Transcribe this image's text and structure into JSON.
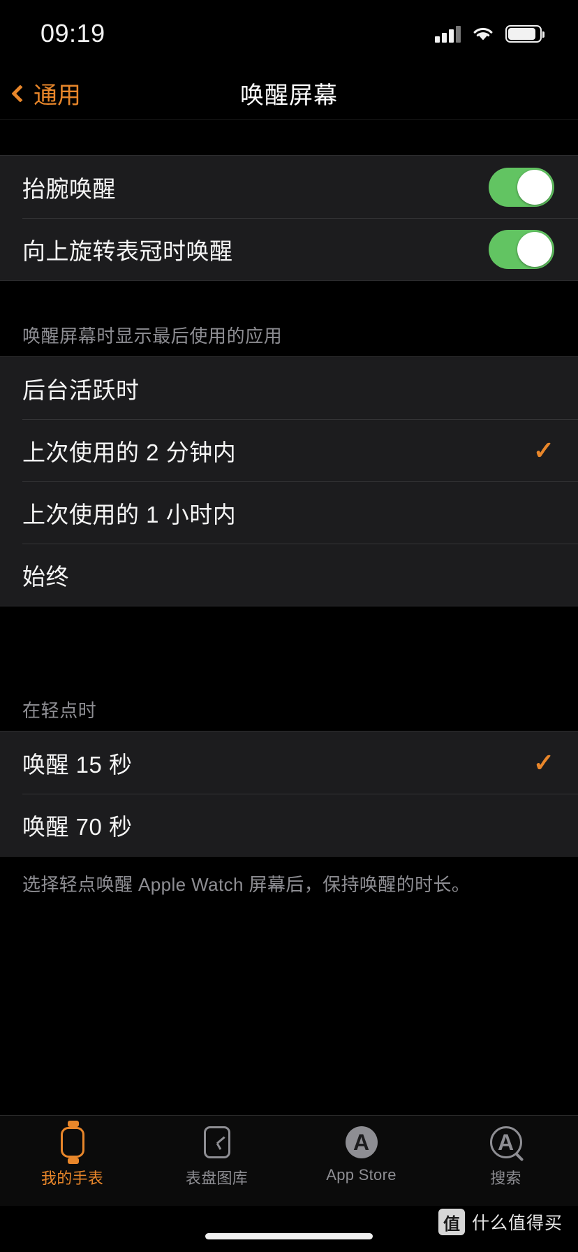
{
  "status": {
    "time": "09:19",
    "signal_icon": "cellular-signal-icon",
    "wifi_icon": "wifi-icon",
    "battery_icon": "battery-icon"
  },
  "nav": {
    "back_label": "通用",
    "title": "唤醒屏幕"
  },
  "toggles": [
    {
      "label": "抬腕唤醒",
      "on": true
    },
    {
      "label": "向上旋转表冠时唤醒",
      "on": true
    }
  ],
  "section_last_app": {
    "header": "唤醒屏幕时显示最后使用的应用",
    "options": [
      {
        "label": "后台活跃时",
        "selected": false
      },
      {
        "label": "上次使用的 2 分钟内",
        "selected": true
      },
      {
        "label": "上次使用的 1 小时内",
        "selected": false
      },
      {
        "label": "始终",
        "selected": false
      }
    ]
  },
  "section_on_tap": {
    "header": "在轻点时",
    "options": [
      {
        "label": "唤醒 15 秒",
        "selected": true
      },
      {
        "label": "唤醒 70 秒",
        "selected": false
      }
    ],
    "footnote": "选择轻点唤醒 Apple Watch 屏幕后，保持唤醒的时长。"
  },
  "tabbar": [
    {
      "label": "我的手表",
      "icon": "watch-icon",
      "active": true
    },
    {
      "label": "表盘图库",
      "icon": "watch-face-icon",
      "active": false
    },
    {
      "label": "App Store",
      "icon": "app-store-icon",
      "active": false
    },
    {
      "label": "搜索",
      "icon": "search-icon",
      "active": false
    }
  ],
  "watermark": {
    "badge": "值",
    "text": "什么值得买"
  },
  "colors": {
    "accent": "#e8862a",
    "toggle_on": "#62c462",
    "group_bg": "#1c1c1e",
    "secondary_text": "#8e8e93"
  },
  "checkmark_glyph": "✓"
}
